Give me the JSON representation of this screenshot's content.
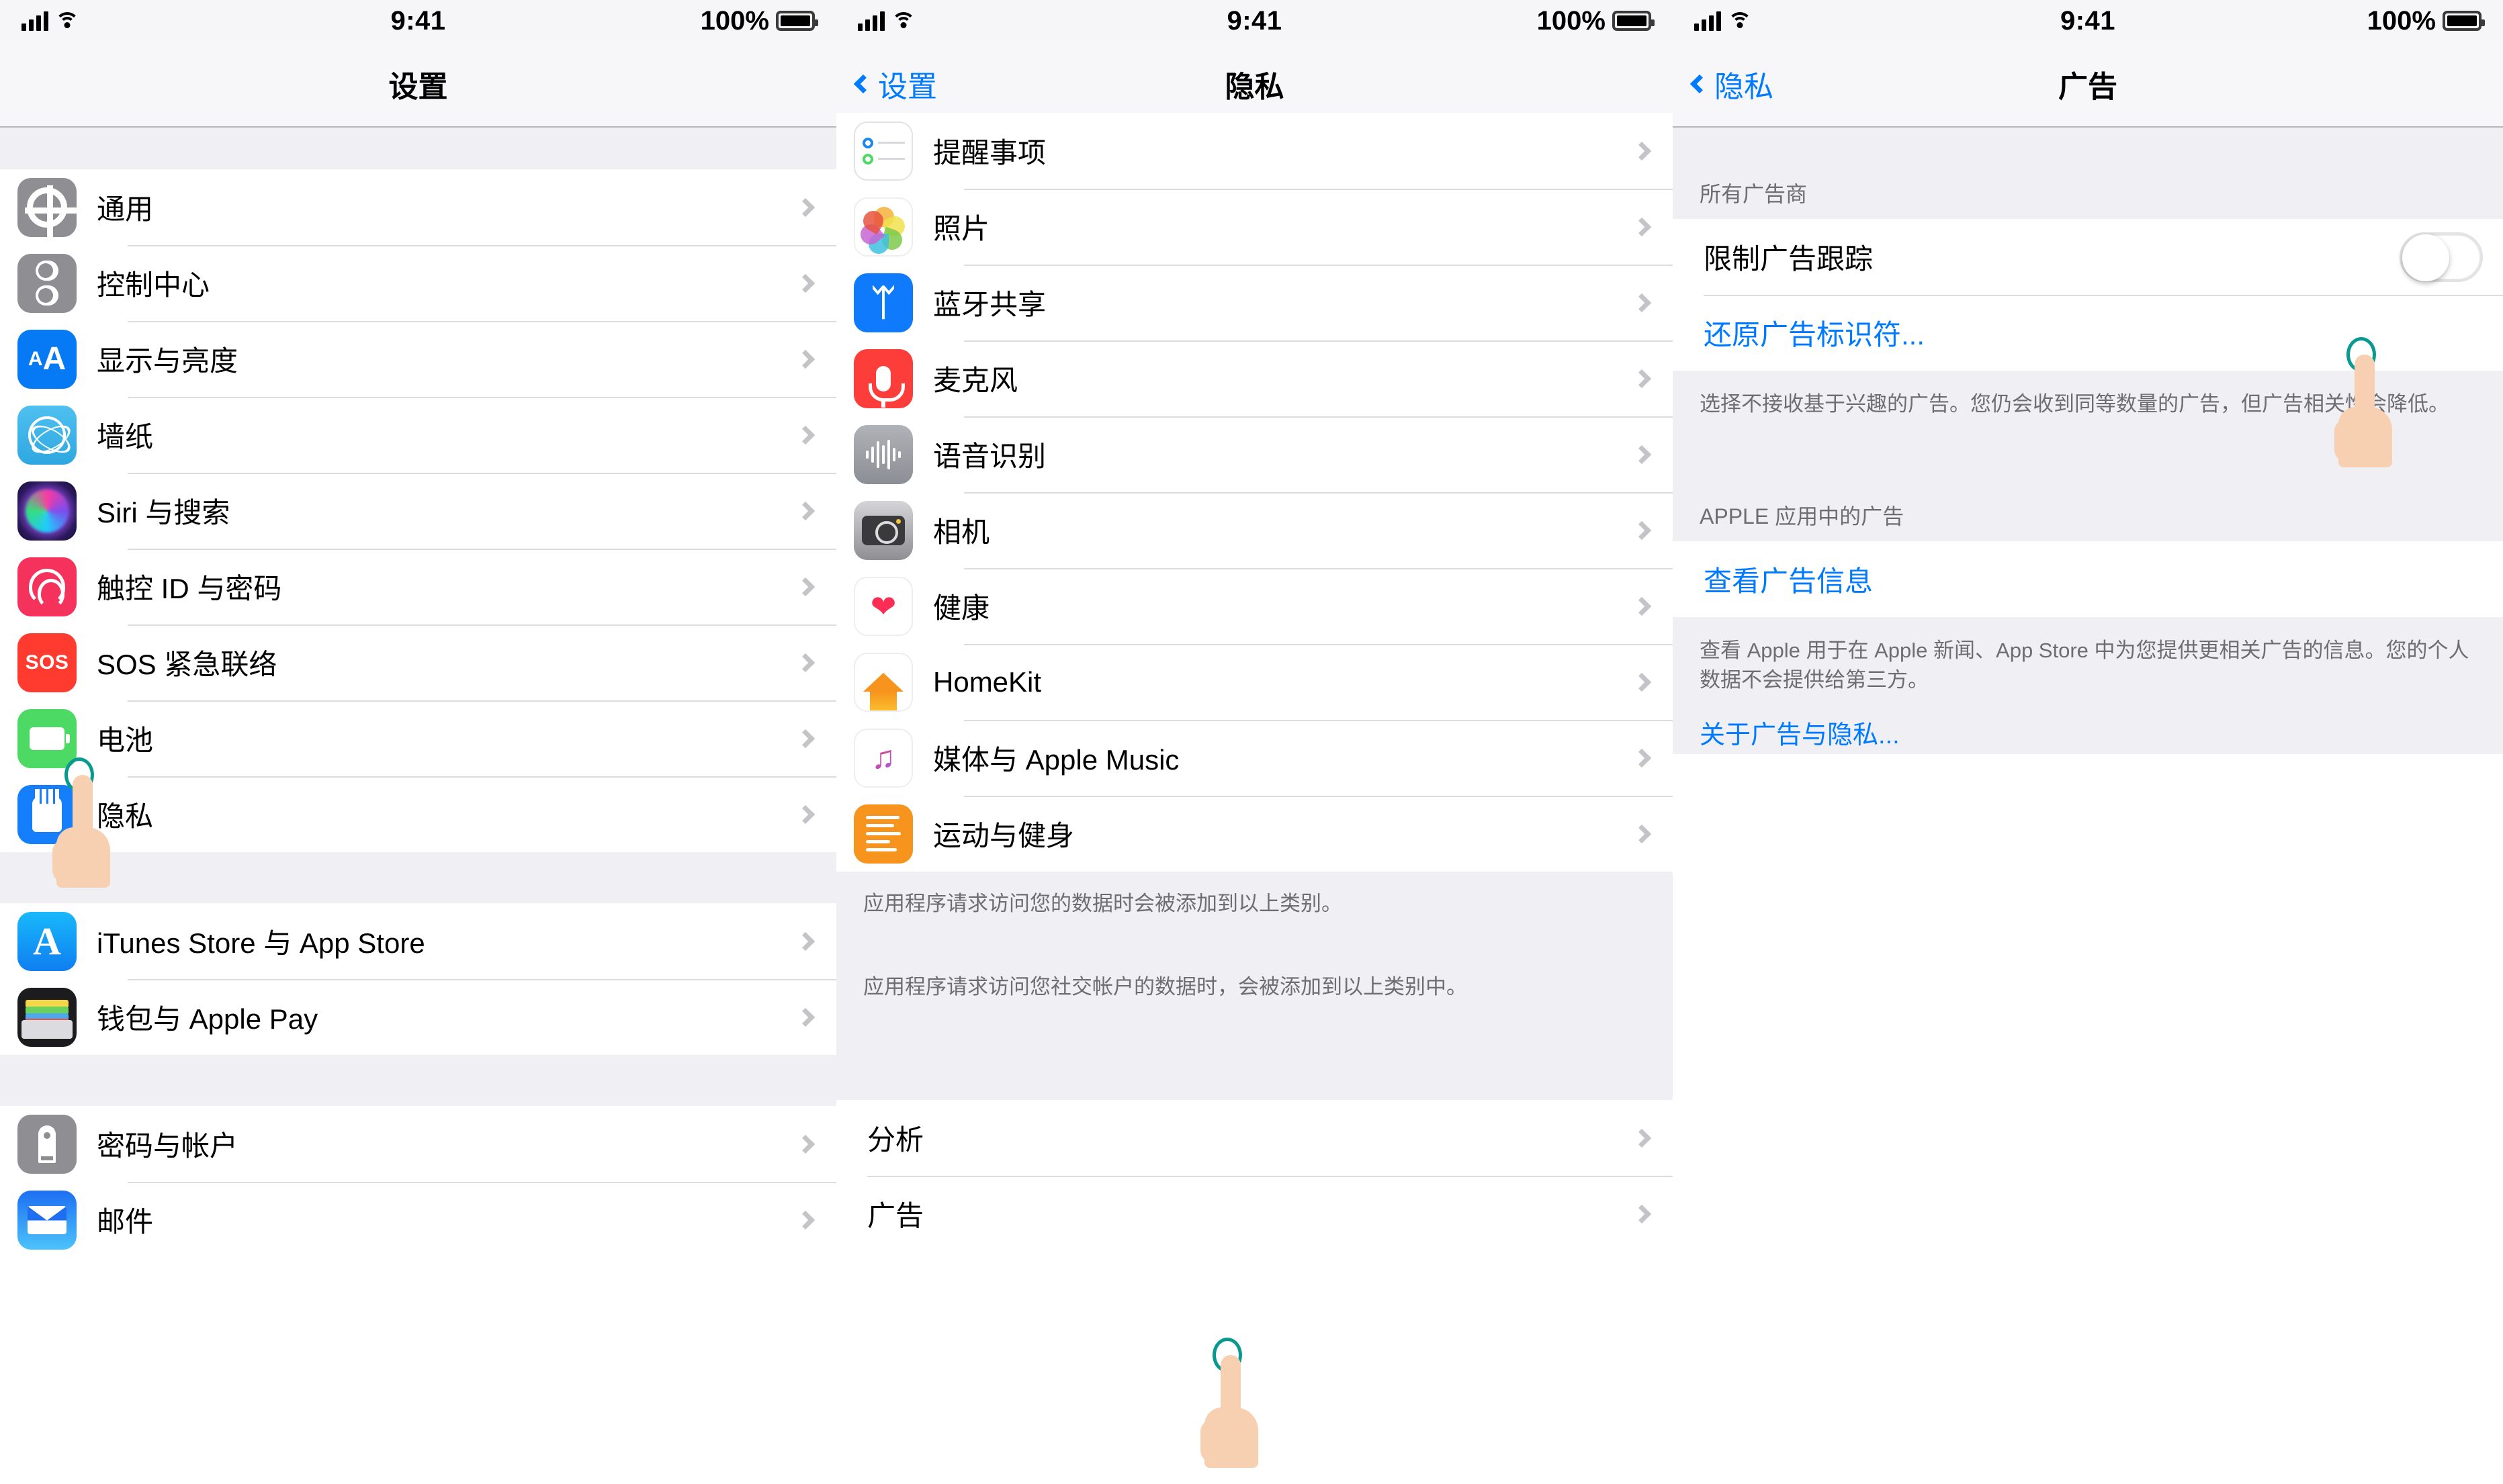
{
  "statusbar": {
    "time": "9:41",
    "battery_pct": "100%"
  },
  "accent_blue": "#007aff",
  "screen1": {
    "title": "设置",
    "groups": [
      {
        "items": [
          {
            "label": "通用",
            "icon": "gear-icon"
          },
          {
            "label": "控制中心",
            "icon": "control-center-icon"
          },
          {
            "label": "显示与亮度",
            "icon": "display-brightness-icon"
          },
          {
            "label": "墙纸",
            "icon": "wallpaper-icon"
          },
          {
            "label": "Siri 与搜索",
            "icon": "siri-icon"
          },
          {
            "label": "触控 ID 与密码",
            "icon": "touch-id-icon"
          },
          {
            "label": "SOS 紧急联络",
            "icon": "sos-icon"
          },
          {
            "label": "电池",
            "icon": "battery-icon"
          },
          {
            "label": "隐私",
            "icon": "privacy-hand-icon"
          }
        ]
      },
      {
        "items": [
          {
            "label": "iTunes Store 与 App Store",
            "icon": "app-store-icon"
          },
          {
            "label": "钱包与 Apple Pay",
            "icon": "wallet-icon"
          }
        ]
      },
      {
        "items": [
          {
            "label": "密码与帐户",
            "icon": "key-icon"
          },
          {
            "label": "邮件",
            "icon": "mail-icon"
          }
        ]
      }
    ]
  },
  "screen2": {
    "back_label": "设置",
    "title": "隐私",
    "groups": [
      {
        "items": [
          {
            "label": "提醒事项",
            "icon": "reminders-icon"
          },
          {
            "label": "照片",
            "icon": "photos-icon"
          },
          {
            "label": "蓝牙共享",
            "icon": "bluetooth-icon"
          },
          {
            "label": "麦克风",
            "icon": "microphone-icon"
          },
          {
            "label": "语音识别",
            "icon": "speech-recognition-icon"
          },
          {
            "label": "相机",
            "icon": "camera-icon"
          },
          {
            "label": "健康",
            "icon": "health-icon"
          },
          {
            "label": "HomeKit",
            "icon": "homekit-icon"
          },
          {
            "label": "媒体与 Apple Music",
            "icon": "apple-music-icon"
          },
          {
            "label": "运动与健身",
            "icon": "motion-fitness-icon"
          }
        ]
      }
    ],
    "footnote1": "应用程序请求访问您的数据时会被添加到以上类别。",
    "footnote2": "应用程序请求访问您社交帐户的数据时，会被添加到以上类别中。",
    "group2": [
      {
        "label": "分析"
      },
      {
        "label": "广告"
      }
    ]
  },
  "screen3": {
    "back_label": "隐私",
    "title": "广告",
    "section1_header": "所有广告商",
    "limit_ad_tracking_label": "限制广告跟踪",
    "limit_ad_tracking_state": "off",
    "reset_ad_id_label": "还原广告标识符...",
    "footnote1": "选择不接收基于兴趣的广告。您仍会收到同等数量的广告，但广告相关性会降低。",
    "section2_header": "APPLE 应用中的广告",
    "view_ad_info_label": "查看广告信息",
    "footnote2": "查看 Apple 用于在 Apple 新闻、App Store 中为您提供更相关广告的信息。您的个人数据不会提供给第三方。",
    "about_ads_privacy_label": "关于广告与隐私..."
  }
}
